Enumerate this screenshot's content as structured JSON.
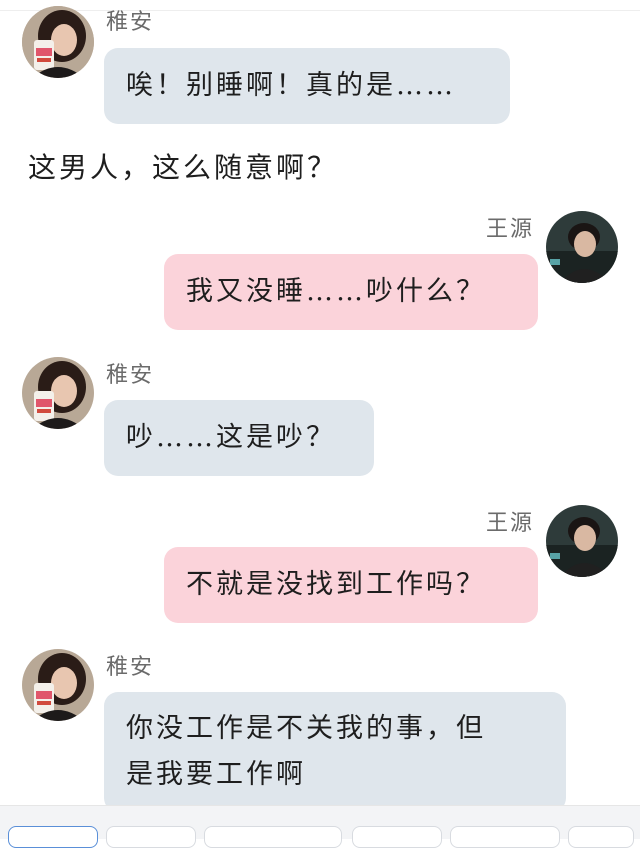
{
  "characters": {
    "her": {
      "name": "稚安",
      "avatar_icon": "girl-portrait-avatar"
    },
    "him": {
      "name": "王源",
      "avatar_icon": "boy-portrait-avatar"
    }
  },
  "messages": [
    {
      "speaker": "稚安",
      "text": "唉！别睡啊！真的是……"
    },
    {
      "speaker": "王源",
      "text": "我又没睡……吵什么？"
    },
    {
      "speaker": "稚安",
      "text": "吵……这是吵？"
    },
    {
      "speaker": "王源",
      "text": "不就是没找到工作吗？"
    },
    {
      "speaker": "稚安",
      "lines": [
        "你没工作是不关我的事，但",
        "是我要工作啊"
      ]
    }
  ],
  "narration": "这男人，这么随意啊？",
  "colors": {
    "her_bubble": "#dfe6ec",
    "him_bubble": "#fbd3da",
    "name_text": "#6b6b6b",
    "active_tab_border": "#5a8fd8"
  }
}
